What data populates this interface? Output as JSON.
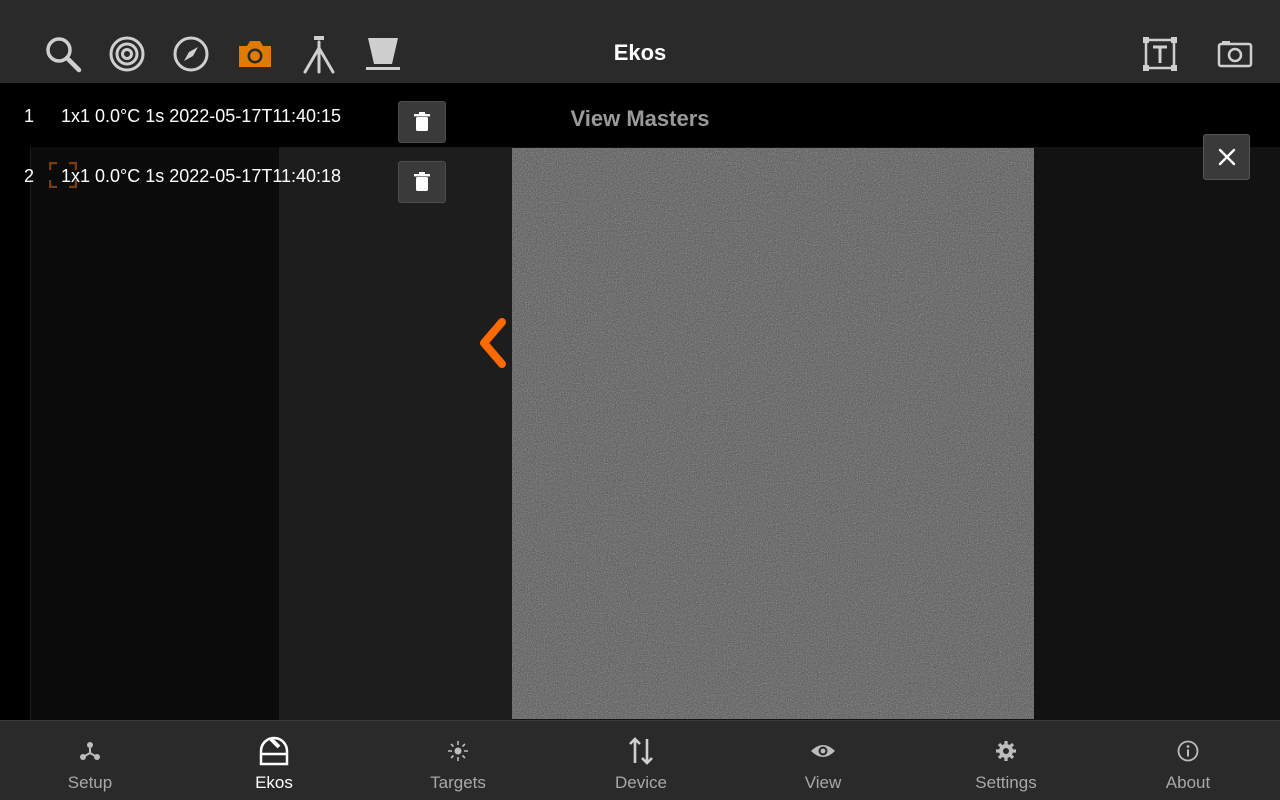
{
  "app": {
    "title": "Ekos"
  },
  "toolbar": {
    "left_icons": [
      "search-icon",
      "target-icon",
      "compass-icon",
      "camera-icon",
      "tripod-icon",
      "filter-icon"
    ],
    "right_icons": [
      "text-frame-icon",
      "screenshot-icon"
    ],
    "active_icon": "camera-icon",
    "accent_color": "#e07b00"
  },
  "frames": [
    {
      "index": "1",
      "label": "1x1 0.0°C 1s 2022-05-17T11:40:15"
    },
    {
      "index": "2",
      "label": "1x1 0.0°C 1s 2022-05-17T11:40:18"
    }
  ],
  "dialog": {
    "title": "View Masters"
  },
  "nav": {
    "items": [
      {
        "label": "Setup",
        "icon": "setup-icon"
      },
      {
        "label": "Ekos",
        "icon": "ekos-icon"
      },
      {
        "label": "Targets",
        "icon": "targets-icon"
      },
      {
        "label": "Device",
        "icon": "device-icon"
      },
      {
        "label": "View",
        "icon": "view-icon"
      },
      {
        "label": "Settings",
        "icon": "settings-icon"
      },
      {
        "label": "About",
        "icon": "about-icon"
      }
    ],
    "active": "Ekos"
  },
  "colors": {
    "chevron": "#ff6a00",
    "bar": "#2a2a2a"
  }
}
